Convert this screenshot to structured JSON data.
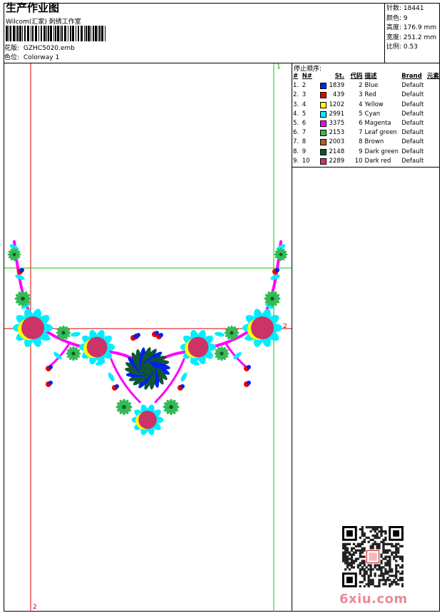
{
  "header": {
    "title": "生产作业图",
    "company": "Wilcom(汇家) 刺绣工作室",
    "design_label": "花版:",
    "design_file": "GZHC5020.emb",
    "colorway_label": "色位:",
    "colorway": "Colorway 1"
  },
  "stats": {
    "stitches_label": "针数:",
    "stitches": "18441",
    "colors_label": "颜色:",
    "colors": "9",
    "height_label": "高度:",
    "height": "176.9 mm",
    "width_label": "宽度:",
    "width": "251.2 mm",
    "scale_label": "比例:",
    "scale": "0.53"
  },
  "stop_sequence": {
    "title": "停止顺序:",
    "headers": {
      "num": "#",
      "n": "N#",
      "st": "St.",
      "code": "代码",
      "desc": "描述",
      "brand": "Brand",
      "element": "元素"
    },
    "rows": [
      {
        "num": "1.",
        "n": "2",
        "color": "#0022ee",
        "st": "1839",
        "code": "2",
        "desc": "Blue",
        "brand": "Default"
      },
      {
        "num": "2.",
        "n": "3",
        "color": "#ee0000",
        "st": "439",
        "code": "3",
        "desc": "Red",
        "brand": "Default"
      },
      {
        "num": "3.",
        "n": "4",
        "color": "#ffff00",
        "st": "1202",
        "code": "4",
        "desc": "Yellow",
        "brand": "Default"
      },
      {
        "num": "4.",
        "n": "5",
        "color": "#00eeff",
        "st": "2991",
        "code": "5",
        "desc": "Cyan",
        "brand": "Default"
      },
      {
        "num": "5.",
        "n": "6",
        "color": "#ff00ff",
        "st": "3375",
        "code": "6",
        "desc": "Magenta",
        "brand": "Default"
      },
      {
        "num": "6.",
        "n": "7",
        "color": "#33bb55",
        "st": "2153",
        "code": "7",
        "desc": "Leaf green",
        "brand": "Default"
      },
      {
        "num": "7.",
        "n": "8",
        "color": "#aa6622",
        "st": "2003",
        "code": "8",
        "desc": "Brown",
        "brand": "Default"
      },
      {
        "num": "8.",
        "n": "9",
        "color": "#115533",
        "st": "2148",
        "code": "9",
        "desc": "Dark green",
        "brand": "Default"
      },
      {
        "num": "9.",
        "n": "10",
        "color": "#cc3366",
        "st": "2289",
        "code": "10",
        "desc": "Dark red",
        "brand": "Default"
      }
    ]
  },
  "canvas": {
    "marker_1": "1",
    "marker_2_right": "2",
    "marker_2_bottom": "2"
  },
  "footer": {
    "site": "6xiu.com"
  }
}
